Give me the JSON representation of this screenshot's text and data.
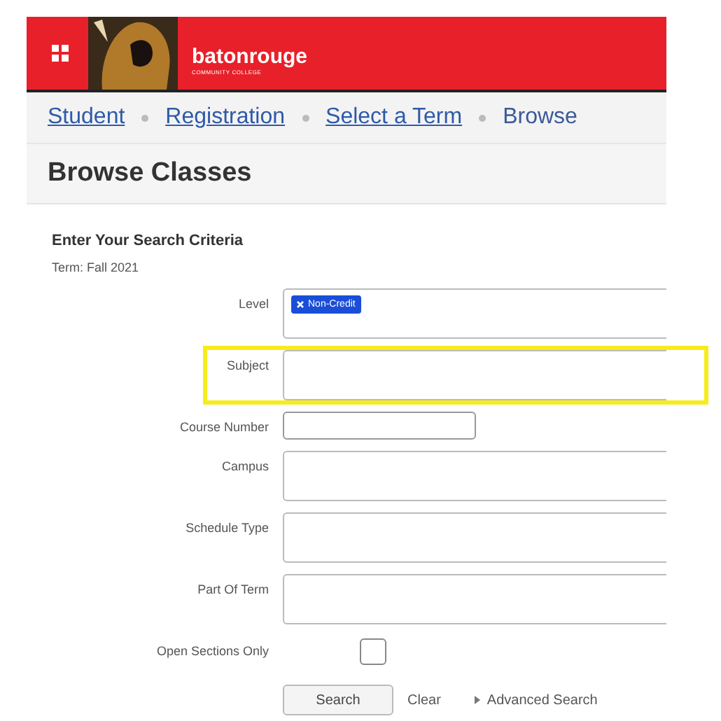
{
  "header": {
    "brand": "batonrouge",
    "brand_sub": "COMMUNITY COLLEGE"
  },
  "breadcrumbs": [
    {
      "label": "Student",
      "link": true
    },
    {
      "label": "Registration",
      "link": true
    },
    {
      "label": "Select a Term",
      "link": true
    },
    {
      "label": "Browse",
      "link": false
    }
  ],
  "page_title": "Browse Classes",
  "form": {
    "heading": "Enter Your Search Criteria",
    "term": "Term: Fall 2021",
    "fields": [
      {
        "label": "Level",
        "kind": "multiselect",
        "chips": [
          "Non-Credit"
        ]
      },
      {
        "label": "Subject",
        "kind": "multiselect",
        "highlighted": true
      },
      {
        "label": "Course Number",
        "kind": "text"
      },
      {
        "label": "Campus",
        "kind": "multiselect"
      },
      {
        "label": "Schedule Type",
        "kind": "multiselect"
      },
      {
        "label": "Part Of Term",
        "kind": "multiselect"
      },
      {
        "label": "Open Sections Only",
        "kind": "checkbox",
        "checked": false
      }
    ],
    "buttons": {
      "search": "Search",
      "clear": "Clear",
      "advanced": "Advanced Search"
    }
  }
}
